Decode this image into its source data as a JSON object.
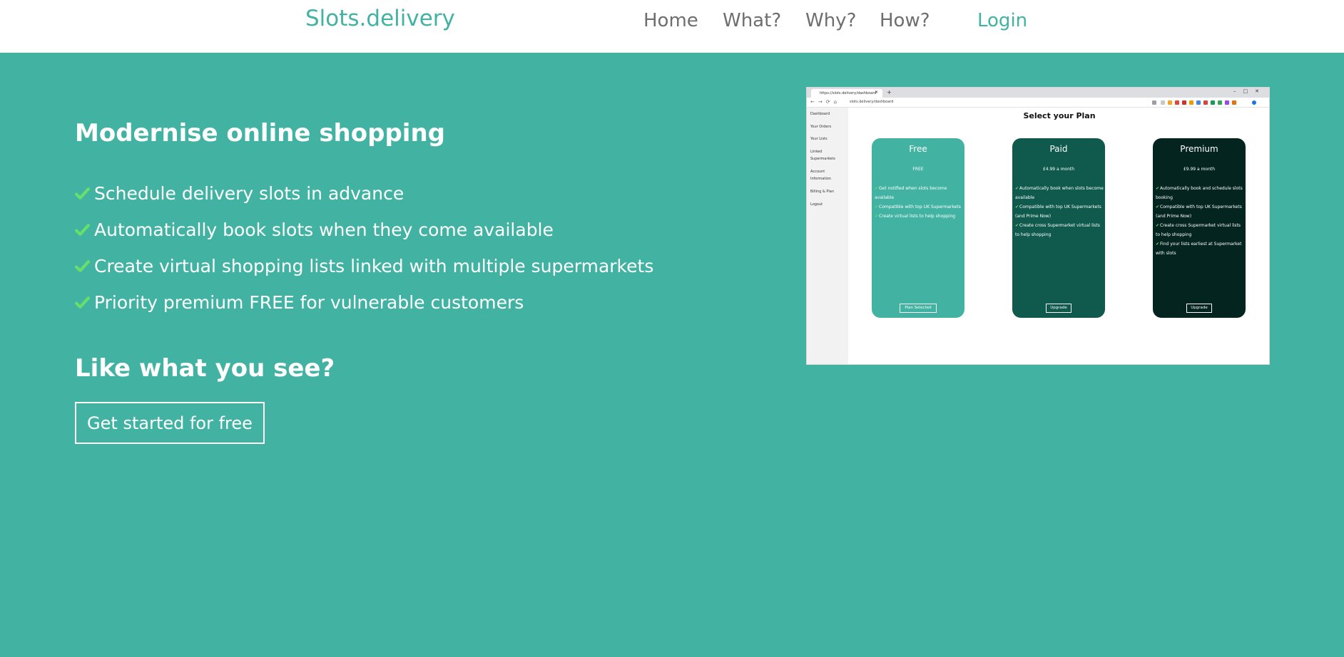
{
  "header": {
    "brand": "Slots.delivery",
    "nav": [
      "Home",
      "What?",
      "Why?",
      "How?"
    ],
    "login": "Login"
  },
  "hero": {
    "heading": "Modernise online shopping",
    "features": [
      "Schedule delivery slots in advance",
      "Automatically book slots when they come available",
      "Create virtual shopping lists linked with multiple supermarkets",
      "Priority premium FREE for vulnerable customers"
    ],
    "subheading": "Like what you see?",
    "cta": "Get started for free"
  },
  "screenshot": {
    "tab_title": "https://slots.delivery/dashboard",
    "url": "slots.delivery/dashboard",
    "sidebar": [
      "Dashboard",
      "Your Orders",
      "Your Lists",
      "Linked Supermarkets",
      "Account Information",
      "Billing & Plan",
      "Logout"
    ],
    "title": "Select your Plan",
    "plans": [
      {
        "name": "Free",
        "price": "FREE",
        "features": [
          "Get notified when slots become available",
          "Compatible with top UK Supermarkets",
          "Create virtual lists to help shopping"
        ],
        "button": "Plan Selected",
        "color": "#42b3a2"
      },
      {
        "name": "Paid",
        "price": "£4.99 a month",
        "features": [
          "Automatically book when slots become available",
          "Compatible with top UK Supermarkets (and Prime Now)",
          "Create cross Supermarket virtual lists to help shopping"
        ],
        "button": "Upgrade",
        "color": "#0f5a4c"
      },
      {
        "name": "Premium",
        "price": "£9.99 a month",
        "features": [
          "Automatically book and schedule slots booking",
          "Compatible with top UK Supermarkets (and Prime Now)",
          "Create cross Supermarket virtual lists to help shopping",
          "Find your lists earliest at Supermarket with slots"
        ],
        "button": "Upgrade",
        "color": "#03241f"
      }
    ]
  },
  "colors": {
    "accent": "#42b3a2",
    "check": "#66e06a",
    "nav_text": "#6e6e6e"
  }
}
